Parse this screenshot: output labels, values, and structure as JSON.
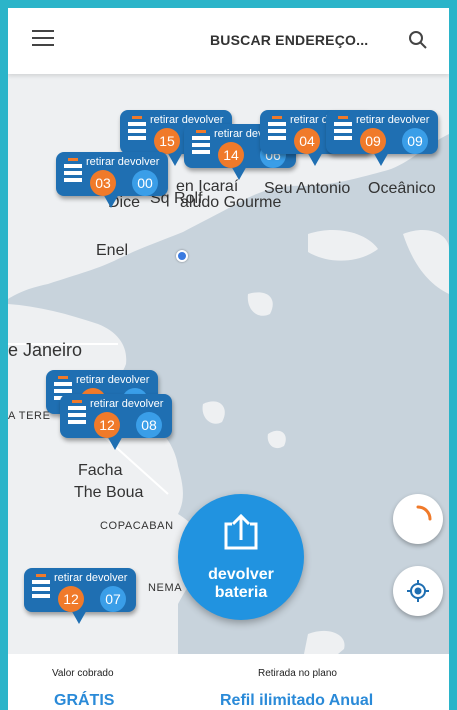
{
  "header": {
    "menu_icon": "hamburger-menu-icon",
    "search_label": "BUSCAR ENDEREÇO...",
    "search_icon": "search-icon"
  },
  "map": {
    "places": {
      "enel": "Enel",
      "dice": "Dice",
      "sq_rolf": "Sq Rolf",
      "icarai": "en Icaraí",
      "aludo": "aludo Gourme",
      "seu_antonio": "Seu Antonio",
      "oceanico": "Oceânico",
      "rio": "e Janeiro",
      "terra": "A TERE",
      "facha": "Facha",
      "the_boua": "The Boua",
      "copacabana": "COPACABAN",
      "nema": "NEMA"
    },
    "markers": [
      {
        "label": "retirar devolver",
        "retirar": "15",
        "devolver": "14"
      },
      {
        "label": "retirar devolver",
        "retirar": "14",
        "devolver": "06"
      },
      {
        "label": "retirar devolver",
        "retirar": "04",
        "devolver": "09"
      },
      {
        "label": "retirar devolver",
        "retirar": "09",
        "devolver": "09"
      },
      {
        "label": "retirar devolver",
        "retirar": "03",
        "devolver": "00"
      },
      {
        "label": "retirar devolver",
        "retirar": "12",
        "devolver": "08"
      },
      {
        "label": "retirar devolver",
        "retirar": "12",
        "devolver": "08"
      },
      {
        "label": "retirar devolver",
        "retirar": "12",
        "devolver": "07"
      }
    ]
  },
  "fab": {
    "line1": "devolver",
    "line2": "bateria",
    "icon": "upload-arrow-icon"
  },
  "buttons": {
    "spinner_icon": "loading-spinner-icon",
    "locate_icon": "my-location-icon"
  },
  "footer": {
    "left_caption": "Valor cobrado",
    "left_value": "GRÁTIS",
    "right_caption": "Retirada no plano",
    "right_value": "Refil ilimitado Anual"
  },
  "colors": {
    "frame": "#2bb4c9",
    "marker": "#1f6fb2",
    "orange": "#f07a2a",
    "blue": "#3a9ee8",
    "fab": "#2193e0"
  }
}
